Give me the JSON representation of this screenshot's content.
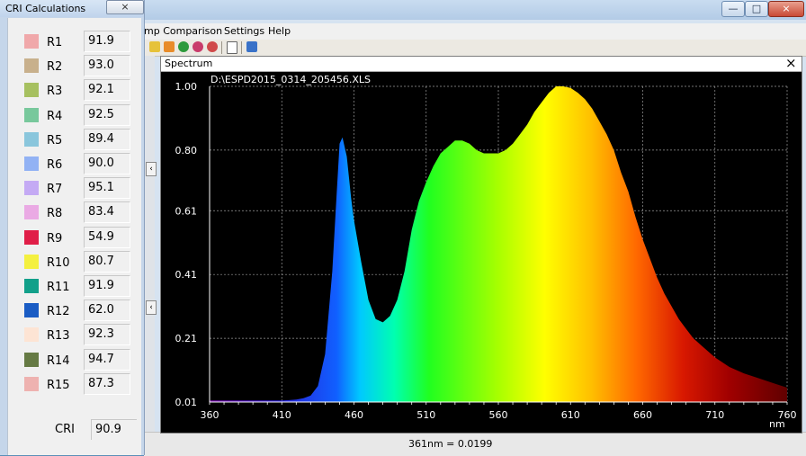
{
  "cri_dialog": {
    "title": "CRI Calculations",
    "close_label": "⨯",
    "rows": [
      {
        "label": "R1",
        "value": "91.9",
        "color": "#f0a8aa"
      },
      {
        "label": "R2",
        "value": "93.0",
        "color": "#c8b08c"
      },
      {
        "label": "R3",
        "value": "92.1",
        "color": "#a6c060"
      },
      {
        "label": "R4",
        "value": "92.5",
        "color": "#78c89c"
      },
      {
        "label": "R5",
        "value": "89.4",
        "color": "#8ac6dc"
      },
      {
        "label": "R6",
        "value": "90.0",
        "color": "#92b2f4"
      },
      {
        "label": "R7",
        "value": "95.1",
        "color": "#c4aaf4"
      },
      {
        "label": "R8",
        "value": "83.4",
        "color": "#eaaae4"
      },
      {
        "label": "R9",
        "value": "54.9",
        "color": "#e01e48"
      },
      {
        "label": "R10",
        "value": "80.7",
        "color": "#f4f040"
      },
      {
        "label": "R11",
        "value": "91.9",
        "color": "#12a08a"
      },
      {
        "label": "R12",
        "value": "62.0",
        "color": "#1a5cc4"
      },
      {
        "label": "R13",
        "value": "92.3",
        "color": "#fde4d4"
      },
      {
        "label": "R14",
        "value": "94.7",
        "color": "#667a44"
      },
      {
        "label": "R15",
        "value": "87.3",
        "color": "#eeb2b0"
      }
    ],
    "cri_label": "CRI",
    "cri_value": "90.9"
  },
  "main_window": {
    "menu": [
      "mp Comparison",
      "Settings",
      "Help"
    ],
    "minimize_label": "—",
    "maximize_label": "□",
    "close_label": "⨯"
  },
  "spectrum_window": {
    "title": "Spectrum",
    "close_label": "×"
  },
  "statusbar": {
    "text": "361nm = 0.0199"
  },
  "chart_data": {
    "type": "area",
    "title": "D:\\ESPD2015_0314_205456.XLS",
    "xlabel": "nm",
    "ylabel": "",
    "xlim": [
      360,
      760
    ],
    "ylim": [
      0.01,
      1.0
    ],
    "x_ticks": [
      360,
      410,
      460,
      510,
      560,
      610,
      660,
      710,
      760
    ],
    "y_ticks": [
      "0.01",
      "0.21",
      "0.41",
      "0.61",
      "0.80",
      "1.00"
    ],
    "grid": true,
    "fill": "visible-spectrum gradient",
    "x": [
      360,
      370,
      380,
      390,
      400,
      410,
      415,
      420,
      425,
      430,
      435,
      440,
      445,
      448,
      450,
      452,
      455,
      458,
      460,
      465,
      470,
      475,
      480,
      485,
      490,
      495,
      500,
      505,
      510,
      515,
      520,
      525,
      530,
      535,
      540,
      545,
      550,
      555,
      560,
      565,
      570,
      575,
      580,
      585,
      590,
      595,
      600,
      605,
      610,
      615,
      620,
      625,
      630,
      635,
      640,
      645,
      650,
      655,
      660,
      665,
      670,
      675,
      680,
      685,
      690,
      695,
      700,
      710,
      720,
      730,
      740,
      750,
      760
    ],
    "y": [
      0.015,
      0.015,
      0.015,
      0.015,
      0.015,
      0.015,
      0.016,
      0.018,
      0.022,
      0.03,
      0.06,
      0.16,
      0.42,
      0.66,
      0.82,
      0.84,
      0.78,
      0.65,
      0.58,
      0.45,
      0.33,
      0.27,
      0.26,
      0.28,
      0.33,
      0.42,
      0.55,
      0.64,
      0.7,
      0.75,
      0.79,
      0.81,
      0.83,
      0.83,
      0.82,
      0.8,
      0.79,
      0.79,
      0.79,
      0.8,
      0.82,
      0.85,
      0.88,
      0.92,
      0.95,
      0.98,
      1.0,
      1.0,
      0.995,
      0.98,
      0.96,
      0.93,
      0.89,
      0.85,
      0.8,
      0.73,
      0.67,
      0.59,
      0.52,
      0.46,
      0.4,
      0.35,
      0.31,
      0.27,
      0.24,
      0.21,
      0.19,
      0.15,
      0.12,
      0.1,
      0.085,
      0.07,
      0.055
    ]
  }
}
